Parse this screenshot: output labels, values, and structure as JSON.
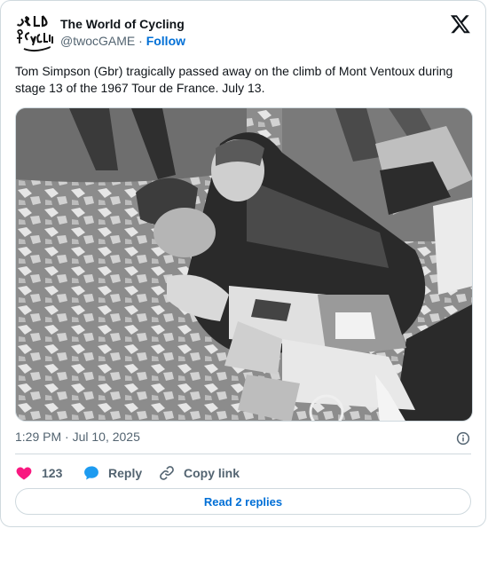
{
  "account": {
    "name": "The World of Cycling",
    "handle": "@twocGAME",
    "separator": "·",
    "follow_label": "Follow",
    "logo_text": "ORLD of CYCLIN"
  },
  "post": {
    "text": "Tom Simpson (Gbr) tragically passed away on the climb of Mont Ventoux during stage 13 of the 1967 Tour de France. July 13.",
    "timestamp": "1:29 PM · Jul 10, 2025"
  },
  "actions": {
    "like_count": "123",
    "reply_label": "Reply",
    "copy_label": "Copy link"
  },
  "read_replies_label": "Read 2 replies",
  "colors": {
    "accent": "#006fd6",
    "like": "#f91880",
    "reply_bubble": "#1d9bf0",
    "muted": "#536471",
    "border": "#cfd9de"
  },
  "icons": {
    "brand": "x-logo-icon",
    "like": "heart-icon",
    "reply": "speech-bubble-icon",
    "copy": "link-icon",
    "info": "info-icon"
  }
}
